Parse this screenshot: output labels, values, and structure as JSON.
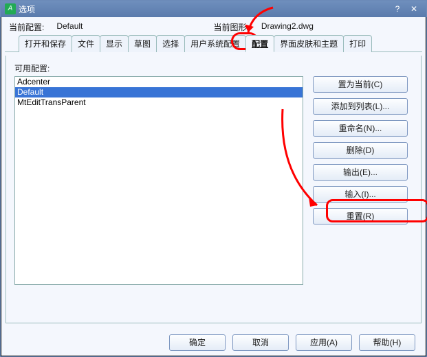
{
  "titlebar": {
    "icon_glyph": "A",
    "title": "选项"
  },
  "info": {
    "current_profile_label": "当前配置:",
    "current_profile_value": "Default",
    "current_drawing_label": "当前图形:",
    "current_drawing_value": "Drawing2.dwg"
  },
  "tabs": {
    "t0": "打开和保存",
    "t1": "文件",
    "t2": "显示",
    "t3": "草图",
    "t4": "选择",
    "t5": "用户系统配置",
    "t6": "配置",
    "t7": "界面皮肤和主题",
    "t8": "打印"
  },
  "section": {
    "available_label": "可用配置:"
  },
  "list": {
    "i0": "Adcenter",
    "i1": "Default",
    "i2": "MtEditTransParent"
  },
  "buttons": {
    "set_current": "置为当前(C)",
    "add_to_list": "添加到列表(L)...",
    "rename": "重命名(N)...",
    "delete": "删除(D)",
    "export": "输出(E)...",
    "import": "输入(I)...",
    "reset": "重置(R)"
  },
  "footer": {
    "ok": "确定",
    "cancel": "取消",
    "apply": "应用(A)",
    "help": "帮助(H)"
  }
}
